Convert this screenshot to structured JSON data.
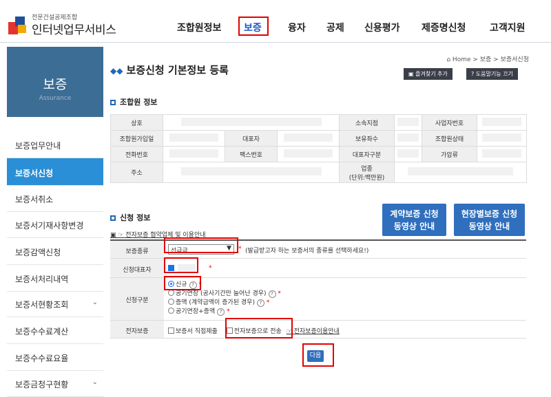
{
  "header": {
    "logo_small": "전문건설공제조합",
    "logo_big": "인터넷업무서비스",
    "nav": [
      "조합원정보",
      "보증",
      "융자",
      "공제",
      "신용평가",
      "제증명신청",
      "고객지원"
    ]
  },
  "sidebar": {
    "title": "보증",
    "subtitle": "Assurance",
    "items": [
      {
        "label": "보증업무안내"
      },
      {
        "label": "보증서신청"
      },
      {
        "label": "보증서취소"
      },
      {
        "label": "보증서기재사항변경"
      },
      {
        "label": "보증감액신청"
      },
      {
        "label": "보증서처리내역"
      },
      {
        "label": "보증서현황조회"
      },
      {
        "label": "보증수수료계산"
      },
      {
        "label": "보증수수료요율"
      },
      {
        "label": "보증금청구현황"
      }
    ],
    "active_item": "보증서신청"
  },
  "main": {
    "breadcrumb": "Home > 보증 > 보증서신청",
    "title": "보증신청 기본정보 등록",
    "bookmark_btn": "즐겨찾기 추가",
    "help_btn": "도움말기능 끄기",
    "member_section": "조합원 정보",
    "info_table": {
      "row1": [
        "상호",
        "소속지점",
        "사업자번호"
      ],
      "row2": [
        "조합원가입일",
        "대표자",
        "보유좌수",
        "조합원상태"
      ],
      "row3": [
        "전화번호",
        "팩스번호",
        "대표자구분",
        "가압류"
      ],
      "row4": [
        "주소",
        "업종",
        "(단위:백만원)"
      ]
    },
    "apply_section": "신청 정보",
    "video_btn1": [
      "계약보증 신청",
      "동영상 안내"
    ],
    "video_btn2": [
      "현장별보증 신청",
      "동영상 안내"
    ],
    "ecompany_link": "☞ 전자보증 협약업체 및 이용안내",
    "form": {
      "type_label": "보증종류",
      "type_value": "선급금",
      "type_hint": "(발급받고자 하는 보증서의 종류를 선택하세요!)",
      "rep_label": "신청대표자",
      "kind_label": "신청구분",
      "kind_options": [
        "신규",
        "공기연장 (공사기간만 늘어난 경우)",
        "증액 (계약금액이 증가된 경우)",
        "공기연장+증액"
      ],
      "kind_selected": "신규",
      "eguar_label": "전자보증",
      "eguar_opt1": "보증서 직접제출",
      "eguar_opt2": "전자보증으로 전송",
      "eguar_link": "☞ 전자보증이용안내"
    },
    "next_btn": "다음"
  },
  "colors": {
    "brand_blue": "#2f6fbd",
    "sidebar_hero": "#3c6d95",
    "sidebar_active": "#2a8fd6",
    "highlight_red": "#e00000"
  }
}
